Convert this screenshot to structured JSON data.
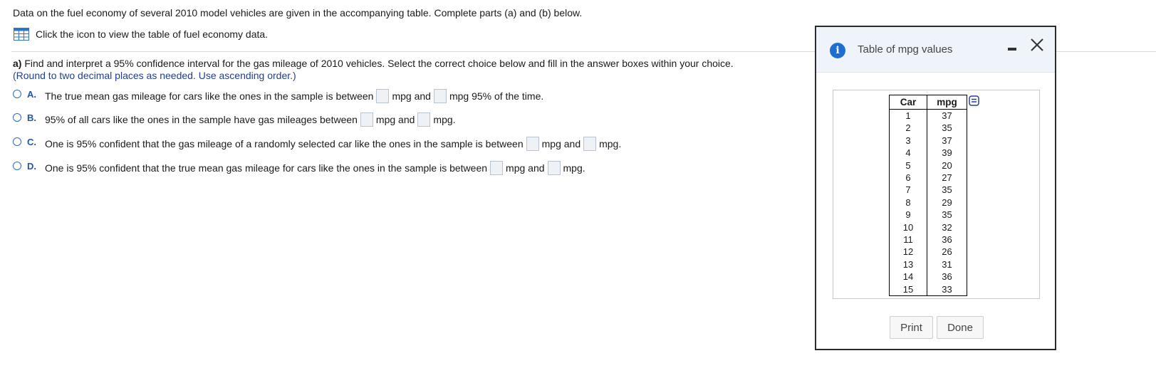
{
  "intro": "Data on the fuel economy of several 2010 model vehicles are given in the accompanying table. Complete parts (a) and (b) below.",
  "view_link": {
    "icon": "table-grid-icon",
    "label": "Click the icon to view the table of fuel economy data."
  },
  "part_a": {
    "label": "a)",
    "question": " Find and interpret a 95% confidence interval for the gas mileage of 2010 vehicles. Select the correct choice below and fill in the answer boxes within your choice.",
    "hint": "(Round to two decimal places as needed. Use ascending order.)"
  },
  "choices": [
    {
      "letter": "A.",
      "before": "The true mean gas mileage for cars like the ones in the sample is between",
      "between": "mpg and",
      "after": "mpg 95% of the time.",
      "low": "",
      "high": ""
    },
    {
      "letter": "B.",
      "before": "95% of all cars like the ones in the sample have gas mileages between",
      "between": "mpg and",
      "after": "mpg.",
      "low": "",
      "high": ""
    },
    {
      "letter": "C.",
      "before": "One is 95% confident that the gas mileage of a randomly selected car like the ones in the sample is between",
      "between": "mpg and",
      "after": "mpg.",
      "low": "",
      "high": ""
    },
    {
      "letter": "D.",
      "before": "One is 95% confident that the true mean gas mileage for cars like the ones in the sample is between",
      "between": "mpg and",
      "after": "mpg.",
      "low": "",
      "high": ""
    }
  ],
  "dialog": {
    "title": "Table of mpg values",
    "info_icon": "info-icon",
    "minimize_icon": "minimize-icon",
    "close_icon": "close-icon",
    "table": {
      "headers": [
        "Car",
        "mpg"
      ],
      "rows": [
        [
          "1",
          "37"
        ],
        [
          "2",
          "35"
        ],
        [
          "3",
          "37"
        ],
        [
          "4",
          "39"
        ],
        [
          "5",
          "20"
        ],
        [
          "6",
          "27"
        ],
        [
          "7",
          "35"
        ],
        [
          "8",
          "29"
        ],
        [
          "9",
          "35"
        ],
        [
          "10",
          "32"
        ],
        [
          "11",
          "36"
        ],
        [
          "12",
          "26"
        ],
        [
          "13",
          "31"
        ],
        [
          "14",
          "36"
        ],
        [
          "15",
          "33"
        ]
      ]
    },
    "copy_icon": "copy-icon",
    "print_label": "Print",
    "done_label": "Done"
  },
  "colors": {
    "accent": "#1f6fd0",
    "choice_letter": "#1f57a8",
    "hint": "#1f3f8f",
    "dialog_header": "#eef4fa"
  }
}
